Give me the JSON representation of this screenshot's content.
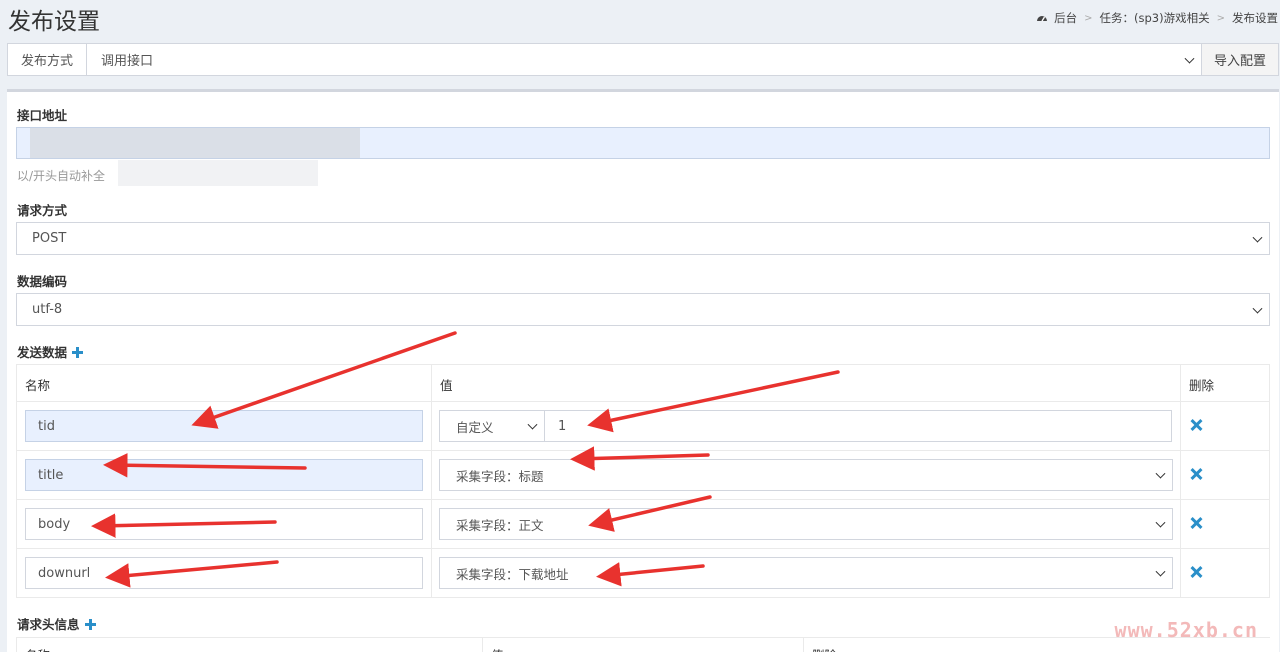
{
  "header": {
    "title": "发布设置",
    "breadcrumb": [
      "后台",
      "任务：(sp3)游戏相关",
      "发布设置"
    ]
  },
  "publish": {
    "label": "发布方式",
    "value": "调用接口",
    "import_button": "导入配置"
  },
  "api": {
    "label": "接口地址",
    "help": "以/开头自动补全"
  },
  "method": {
    "label": "请求方式",
    "value": "POST"
  },
  "encoding": {
    "label": "数据编码",
    "value": "utf-8"
  },
  "send_data": {
    "label": "发送数据",
    "columns": [
      "名称",
      "值",
      "删除"
    ],
    "rows": [
      {
        "name": "tid",
        "type": "自定义",
        "value": "1"
      },
      {
        "name": "title",
        "value": "采集字段：标题"
      },
      {
        "name": "body",
        "value": "采集字段：正文"
      },
      {
        "name": "downurl",
        "value": "采集字段：下载地址"
      }
    ]
  },
  "headers": {
    "label": "请求头信息",
    "columns": [
      "名称",
      "值",
      "删除"
    ]
  },
  "watermark": "www.52xb.cn",
  "colors": {
    "accent": "#2a8fc9",
    "arrow": "#e8322e"
  }
}
